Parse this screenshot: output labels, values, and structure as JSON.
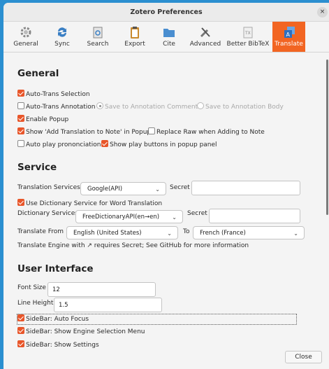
{
  "window": {
    "title": "Zotero Preferences",
    "close_glyph": "×"
  },
  "toolbar": {
    "tabs": [
      {
        "label": "General",
        "icon": "gear-icon"
      },
      {
        "label": "Sync",
        "icon": "sync-icon"
      },
      {
        "label": "Search",
        "icon": "search-icon"
      },
      {
        "label": "Export",
        "icon": "clipboard-icon"
      },
      {
        "label": "Cite",
        "icon": "folder-icon"
      },
      {
        "label": "Advanced",
        "icon": "tools-icon"
      },
      {
        "label": "Better BibTeX",
        "icon": "bibtex-icon"
      },
      {
        "label": "Translate",
        "icon": "translate-icon",
        "selected": true
      }
    ]
  },
  "general": {
    "heading": "General",
    "auto_trans_selection": {
      "label": "Auto-Trans Selection",
      "checked": true
    },
    "auto_trans_annotation": {
      "label": "Auto-Trans Annotation",
      "checked": false
    },
    "save_to_annotation_comment": {
      "label": "Save to Annotation Comment",
      "selected": true
    },
    "save_to_annotation_body": {
      "label": "Save to Annotation Body",
      "selected": false
    },
    "enable_popup": {
      "label": "Enable Popup",
      "checked": true
    },
    "show_add_translation": {
      "label": "Show 'Add Translation to Note' in Popup",
      "checked": true
    },
    "replace_raw": {
      "label": "Replace Raw when Adding to Note",
      "checked": false
    },
    "auto_play": {
      "label": "Auto play prononciation",
      "checked": false
    },
    "show_play_buttons": {
      "label": "Show play buttons in popup panel",
      "checked": true
    }
  },
  "service": {
    "heading": "Service",
    "translation_services_label": "Translation Services",
    "translation_service_value": "Google(API)",
    "secret_label": "Secret",
    "secret_value": "",
    "use_dictionary": {
      "label": "Use Dictionary Service for Word Translation",
      "checked": true
    },
    "dictionary_services_label": "Dictionary Services",
    "dictionary_service_value": "FreeDictionaryAPI(en→en)",
    "dictionary_secret_label": "Secret",
    "dictionary_secret_value": "",
    "translate_from_label": "Translate From",
    "translate_from_value": "English (United States)",
    "to_label": "To",
    "translate_to_value": "French (France)",
    "note": "Translate Engine with ↗ requires Secret; See GitHub for more information"
  },
  "ui": {
    "heading": "User Interface",
    "font_size_label": "Font Size",
    "font_size_value": "12",
    "line_height_label": "Line Height",
    "line_height_value": "1.5",
    "sidebar_auto_focus": {
      "label": "SideBar: Auto Focus",
      "checked": true
    },
    "sidebar_engine_menu": {
      "label": "SideBar: Show Engine Selection Menu",
      "checked": true
    },
    "sidebar_settings": {
      "label": "SideBar: Show Settings",
      "checked": true
    }
  },
  "footer": {
    "close_label": "Close"
  },
  "colors": {
    "accent": "#f26522",
    "checkbox": "#e8562a",
    "desktop": "#2b8fd0"
  }
}
